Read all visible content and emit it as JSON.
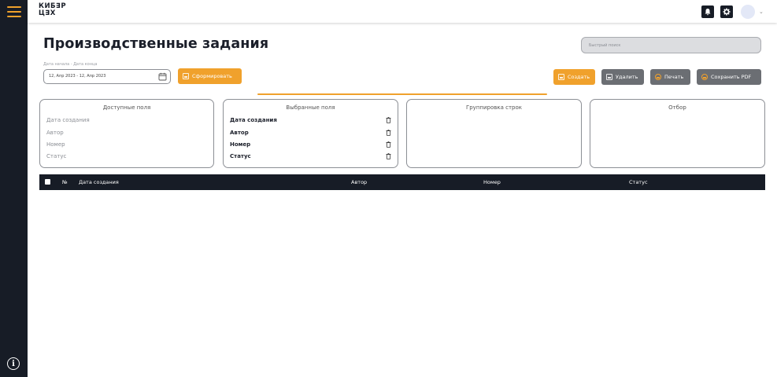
{
  "header": {
    "logo_line1": "КИБ∃Р",
    "logo_line2": "Ц∃Х",
    "icons": [
      "menu-icon",
      "bell-icon",
      "gear-icon",
      "avatar",
      "chevron-down-icon",
      "info-icon"
    ]
  },
  "page": {
    "title": "Производственные задания",
    "search_placeholder": "Быстрый поиск"
  },
  "filters": {
    "date_label": "Дата начала - Дата конца",
    "date_value": "12, Апр 2023 - 12, Апр 2023",
    "form_button": "Сформировать"
  },
  "toolbar": {
    "create": "Создать",
    "delete": "Удалить",
    "print": "Печать",
    "save_pdf": "Сохранить PDF"
  },
  "panels": {
    "available": {
      "title": "Доступные поля",
      "items": [
        "Дата создания",
        "Автор",
        "Номер",
        "Статус"
      ]
    },
    "selected": {
      "title": "Выбранные поля",
      "items": [
        "Дата создания",
        "Автор",
        "Номер",
        "Статус"
      ]
    },
    "grouping": {
      "title": "Группировка строк"
    },
    "filter": {
      "title": "Отбор"
    }
  },
  "table": {
    "columns": [
      "№",
      "Дата создания",
      "Автор",
      "Номер",
      "Статус"
    ],
    "rows": []
  },
  "colors": {
    "sidebar": "#171c26",
    "accent": "#f0a12c",
    "gray_button": "#6b6e73",
    "table_header": "#171c26"
  }
}
